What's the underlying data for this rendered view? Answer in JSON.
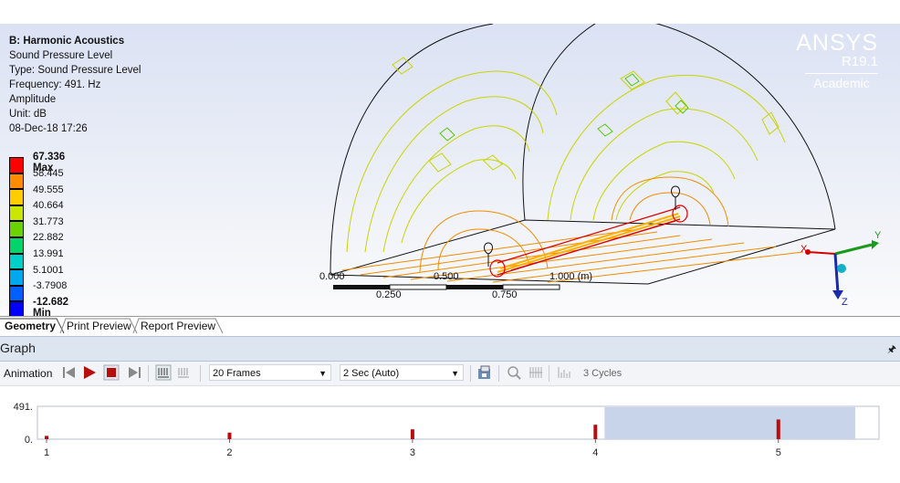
{
  "info": {
    "title": "B: Harmonic Acoustics",
    "lines": [
      "Sound Pressure Level",
      "Type: Sound Pressure Level",
      "Frequency: 491. Hz",
      "Amplitude",
      "Unit: dB",
      "08-Dec-18 17:26"
    ]
  },
  "legend": {
    "labels": [
      "67.336 Max",
      "58.445",
      "49.555",
      "40.664",
      "31.773",
      "22.882",
      "13.991",
      "5.1001",
      "-3.7908",
      "-12.682 Min"
    ],
    "colors": [
      "#ff0000",
      "#ff8c00",
      "#ffcc00",
      "#c8e600",
      "#6bd400",
      "#00d46a",
      "#00d0c8",
      "#00a8ee",
      "#0060ff",
      "#0000ff"
    ]
  },
  "logo": {
    "brand": "ANSYS",
    "release": "R19.1",
    "edition": "Academic"
  },
  "scale": {
    "labels": [
      "0.000",
      "0.500",
      "1.000 (m)",
      "0.250",
      "0.750"
    ]
  },
  "triad": {
    "x": "X",
    "y": "Y",
    "z": "Z"
  },
  "tabs": [
    "Geometry",
    "Print Preview",
    "Report Preview"
  ],
  "graph": {
    "title": "Graph",
    "pin": "ᵠ",
    "animation_label": "Animation",
    "frames": "20 Frames",
    "duration": "2 Sec (Auto)",
    "cycles": "3 Cycles"
  },
  "chart_data": {
    "type": "bar",
    "x": [
      1,
      2,
      3,
      4,
      5
    ],
    "values": [
      0.1,
      0.2,
      0.3,
      0.44,
      0.6
    ],
    "ytick_labels": [
      "491.",
      "0."
    ],
    "xtick_labels": [
      "1",
      "2",
      "3",
      "4",
      "5"
    ],
    "ylim": [
      0,
      1
    ],
    "xlim": [
      0.95,
      5.55
    ],
    "highlight_range": [
      4.05,
      5.42
    ],
    "bar_color": "#b80d0d",
    "highlight_color": "#c7d4ea"
  }
}
